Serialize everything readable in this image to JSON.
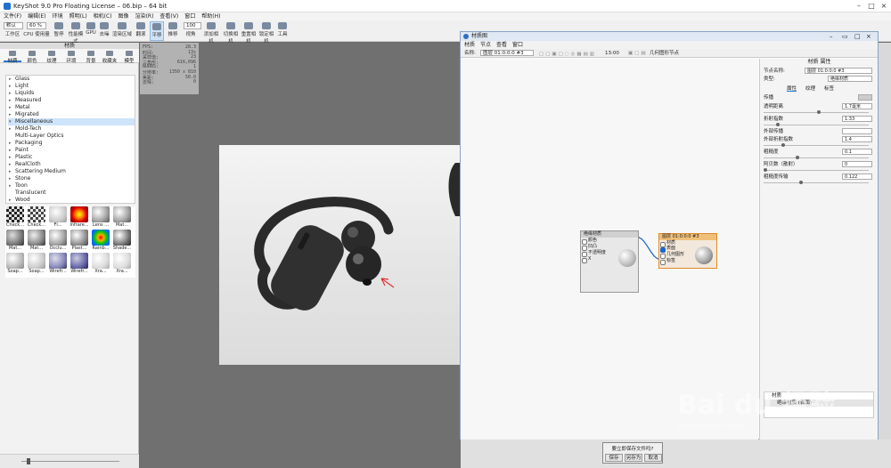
{
  "window": {
    "title": "KeyShot 9.0 Pro Floating License  –  06.bip  –  64 bit"
  },
  "menubar": [
    "文件(F)",
    "编辑(E)",
    "环境",
    "照明(L)",
    "相机(C)",
    "图像",
    "渲染(R)",
    "查看(V)",
    "窗口",
    "帮助(H)"
  ],
  "toolbar": {
    "preset_value": "默认",
    "percent_value": "60 %",
    "zoom_value": "100",
    "items": [
      "工作区",
      "CPU 使用量",
      "暂停",
      "性能模式",
      "GPU",
      "去噪",
      "渲染区域",
      "翻滚",
      "平移",
      "推移",
      "视角",
      "添加相机",
      "切换相机",
      "重置相机",
      "锁定相机",
      "工具"
    ]
  },
  "left_panel": {
    "title": "材质",
    "tabs": [
      "材质",
      "颜色",
      "纹理",
      "环境",
      "背景",
      "收藏夹",
      "模型"
    ],
    "list": [
      "Glass",
      "Light",
      "Liquids",
      "Measured",
      "Metal",
      "Migrated",
      "Miscellaneous",
      "Mold-Tech",
      "Multi-Layer Optics",
      "Packaging",
      "Paint",
      "Plastic",
      "RealCloth",
      "Scattering Medium",
      "Stone",
      "Toon",
      "Translucent",
      "Wood"
    ],
    "selected": "Miscellaneous",
    "thumbs": [
      "Check...",
      "Check...",
      "Fl...",
      "Infrare...",
      "Lens ...",
      "Mat...",
      "Mat...",
      "Mat...",
      "Occlu...",
      "Plast...",
      "Rainb...",
      "Shade...",
      "Soap...",
      "Soap...",
      "Wirefr...",
      "Wirefr...",
      "Xra...",
      "Xra..."
    ]
  },
  "hud": [
    [
      "FPS:",
      "28.3"
    ],
    [
      "时间:",
      "13s"
    ],
    [
      "采样值:",
      "23"
    ],
    [
      "三角形:",
      "616,096"
    ],
    [
      "NURBS:",
      "1"
    ],
    [
      "分辨率:",
      "1350 x 810"
    ],
    [
      "焦距:",
      "50.0"
    ],
    [
      "去噪:",
      "0"
    ]
  ],
  "node_editor": {
    "title": "材质图",
    "menu": [
      "材质",
      "节点",
      "查看",
      "窗口"
    ],
    "toolbar_name_label": "名称:",
    "toolbar_name_value": "图层 01:0:0:0 #3",
    "toolbar_ratio": "13:00",
    "toolbar_label2": "几何图形节点",
    "node1": {
      "title": "绝缘材质",
      "ports": [
        "颜色",
        "凹凸",
        "不透明度",
        "X"
      ]
    },
    "node2": {
      "title": "图层 01:0:0:0 #3",
      "subtitle": "材质",
      "ports": [
        "表面",
        "几何图形",
        "标签"
      ]
    },
    "props": {
      "header": "材质 属性",
      "name_label": "节点名称:",
      "name_value": "图层 01:0:0:0 #3",
      "type_label": "类型:",
      "type_value": "绝缘材质",
      "tabs": [
        "属性",
        "纹理",
        "标签"
      ],
      "rows": [
        {
          "label": "传播",
          "value": ""
        },
        {
          "label": "透明距离",
          "value": "1.7毫米"
        },
        {
          "label": "折射指数",
          "value": "1.33"
        },
        {
          "label": "外部传播",
          "value": ""
        },
        {
          "label": "外部折射指数",
          "value": "1.4"
        },
        {
          "label": "粗糙度",
          "value": "0.1"
        },
        {
          "label": "阿贝数（散射）",
          "value": "0"
        },
        {
          "label": "粗糙度传输",
          "value": "0.122"
        }
      ],
      "tree": [
        "材质",
        "绝缘材质 (表面)"
      ]
    }
  },
  "save_dialog": {
    "question": "要立即保存文件吗?",
    "buttons": [
      "保存",
      "另存为",
      "取消"
    ]
  },
  "watermark": {
    "text": "Bai du 经验",
    "sub": "jingyan.baidu.com"
  }
}
